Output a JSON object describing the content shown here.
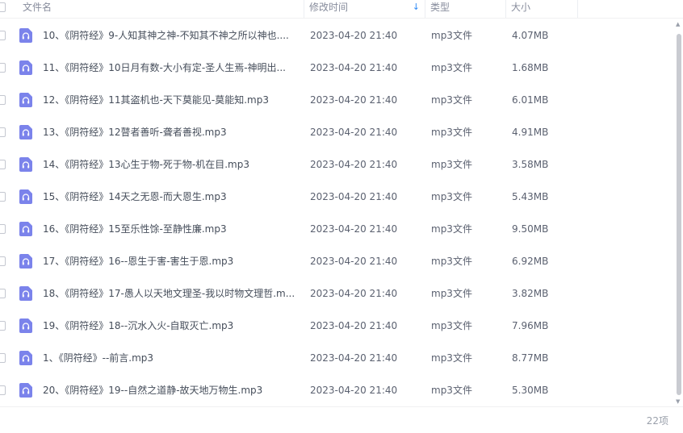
{
  "header": {
    "name": "文件名",
    "modified": "修改时间",
    "type": "类型",
    "size": "大小"
  },
  "files": [
    {
      "name": "10、《阴符经》9-人知其神之神-不知其不神之所以神也....",
      "date": "2023-04-20 21:40",
      "type": "mp3文件",
      "size": "4.07MB"
    },
    {
      "name": "11、《阴符经》10日月有数-大小有定-圣人生焉-神明出...",
      "date": "2023-04-20 21:40",
      "type": "mp3文件",
      "size": "1.68MB"
    },
    {
      "name": "12、《阴符经》11其盗机也-天下莫能见-莫能知.mp3",
      "date": "2023-04-20 21:40",
      "type": "mp3文件",
      "size": "6.01MB"
    },
    {
      "name": "13、《阴符经》12瞽者善听-聋者善视.mp3",
      "date": "2023-04-20 21:40",
      "type": "mp3文件",
      "size": "4.91MB"
    },
    {
      "name": "14、《阴符经》13心生于物-死于物-机在目.mp3",
      "date": "2023-04-20 21:40",
      "type": "mp3文件",
      "size": "3.58MB"
    },
    {
      "name": "15、《阴符经》14天之无恩-而大恩生.mp3",
      "date": "2023-04-20 21:40",
      "type": "mp3文件",
      "size": "5.43MB"
    },
    {
      "name": "16、《阴符经》15至乐性馀-至静性廉.mp3",
      "date": "2023-04-20 21:40",
      "type": "mp3文件",
      "size": "9.50MB"
    },
    {
      "name": "17、《阴符经》16--恩生于害-害生于恩.mp3",
      "date": "2023-04-20 21:40",
      "type": "mp3文件",
      "size": "6.92MB"
    },
    {
      "name": "18、《阴符经》17-愚人以天地文理圣-我以时物文理哲.m...",
      "date": "2023-04-20 21:40",
      "type": "mp3文件",
      "size": "3.82MB"
    },
    {
      "name": "19、《阴符经》18--沉水入火-自取灭亡.mp3",
      "date": "2023-04-20 21:40",
      "type": "mp3文件",
      "size": "7.96MB"
    },
    {
      "name": "1、《阴符经》--前言.mp3",
      "date": "2023-04-20 21:40",
      "type": "mp3文件",
      "size": "8.77MB"
    },
    {
      "name": "20、《阴符经》19--自然之道静-故天地万物生.mp3",
      "date": "2023-04-20 21:40",
      "type": "mp3文件",
      "size": "5.30MB"
    }
  ],
  "footer": {
    "count": "22项"
  },
  "icons": {
    "file": "audio-file-icon",
    "sort": "sort-down-arrow-icon"
  },
  "colors": {
    "file_icon": "#7b83eb",
    "accent": "#2f8af5"
  }
}
